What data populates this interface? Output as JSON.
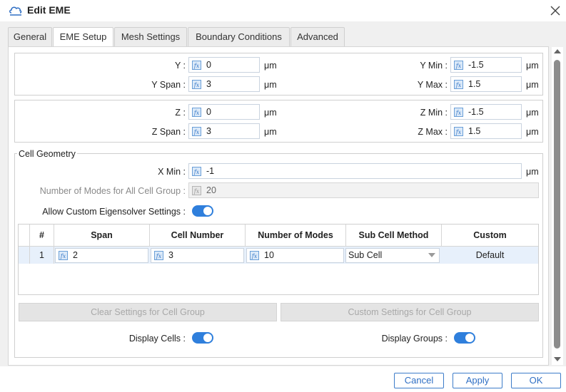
{
  "window": {
    "title": "Edit EME"
  },
  "tabs": [
    {
      "label": "General",
      "active": false
    },
    {
      "label": "EME Setup",
      "active": true
    },
    {
      "label": "Mesh Settings",
      "active": false
    },
    {
      "label": "Boundary Conditions",
      "active": false
    },
    {
      "label": "Advanced",
      "active": false
    }
  ],
  "y_group": {
    "y": {
      "label": "Y :",
      "value": "0",
      "unit": "μm"
    },
    "y_span": {
      "label": "Y Span :",
      "value": "3",
      "unit": "μm"
    },
    "y_min": {
      "label": "Y Min :",
      "value": "-1.5",
      "unit": "μm"
    },
    "y_max": {
      "label": "Y Max :",
      "value": "1.5",
      "unit": "μm"
    }
  },
  "z_group": {
    "z": {
      "label": "Z :",
      "value": "0",
      "unit": "μm"
    },
    "z_span": {
      "label": "Z Span :",
      "value": "3",
      "unit": "μm"
    },
    "z_min": {
      "label": "Z Min :",
      "value": "-1.5",
      "unit": "μm"
    },
    "z_max": {
      "label": "Z Max :",
      "value": "1.5",
      "unit": "μm"
    }
  },
  "cell_geometry": {
    "title": "Cell Geometry",
    "x_min": {
      "label": "X Min :",
      "value": "-1",
      "unit": "μm"
    },
    "num_modes": {
      "label": "Number of Modes for All Cell Group :",
      "value": "20"
    },
    "custom_eigensolver": {
      "label": "Allow Custom Eigensolver Settings :",
      "on": true
    },
    "table": {
      "headers": [
        "#",
        "Span",
        "Cell Number",
        "Number of Modes",
        "Sub Cell Method",
        "Custom"
      ],
      "rows": [
        {
          "index": "1",
          "span": "2",
          "cell_number": "3",
          "number_of_modes": "10",
          "sub_cell_method": "Sub Cell",
          "custom": "Default"
        }
      ]
    },
    "clear_button": "Clear Settings for Cell Group",
    "custom_button": "Custom Settings for Cell Group",
    "display_cells": {
      "label": "Display Cells :",
      "on": true
    },
    "display_groups": {
      "label": "Display Groups :",
      "on": true
    }
  },
  "icons": {
    "formula": "fx"
  },
  "footer": {
    "cancel": "Cancel",
    "apply": "Apply",
    "ok": "OK"
  },
  "colors": {
    "accent": "#2f7fdc",
    "row_selected": "#e7f0fb"
  }
}
